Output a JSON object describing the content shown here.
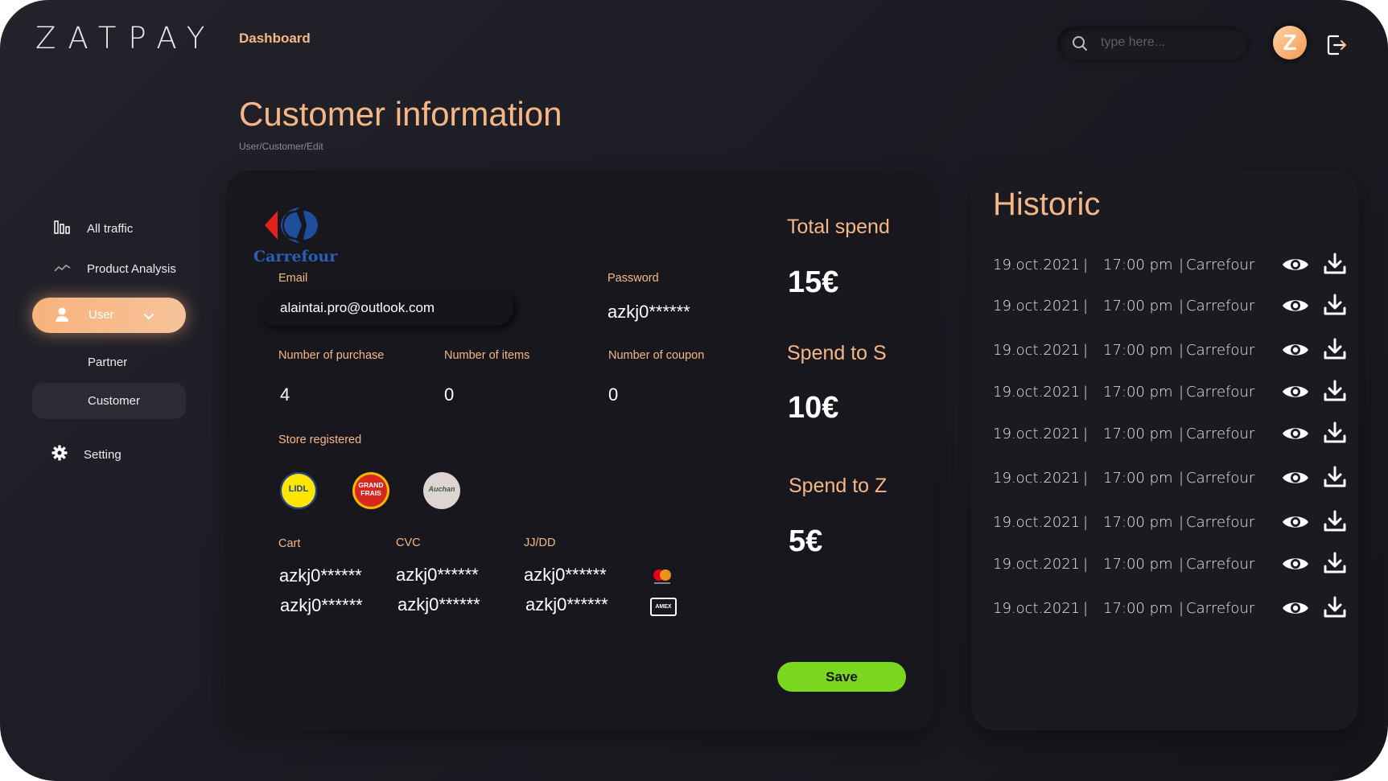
{
  "header": {
    "logo": "ZATPAY",
    "nav_active": "Dashboard",
    "search_placeholder": "type here...",
    "avatar_letter": "Z"
  },
  "page": {
    "title": "Customer information",
    "breadcrumb": "User/Customer/Edit"
  },
  "sidebar": {
    "items": [
      {
        "label": "All traffic",
        "icon": "bar-chart-icon"
      },
      {
        "label": "Product Analysis",
        "icon": "trend-line-icon"
      },
      {
        "label": "User",
        "icon": "user-icon",
        "active": true
      },
      {
        "label": "Partner"
      },
      {
        "label": "Customer",
        "selected": true
      },
      {
        "label": "Setting",
        "icon": "gear-icon"
      }
    ]
  },
  "customer": {
    "brand": "Carrefour",
    "email_label": "Email",
    "email_value": "alaintai.pro@outlook.com",
    "password_label": "Password",
    "password_value": "azkj0******",
    "purchases_label": "Number of purchase",
    "purchases_value": "4",
    "items_label": "Number of items",
    "items_value": "0",
    "coupon_label": "Number of coupon",
    "coupon_value": "0",
    "stores_label": "Store registered",
    "stores": [
      "LIDL",
      "GRAND FRAIS",
      "Auchan"
    ],
    "cart_label": "Cart",
    "cvc_label": "CVC",
    "date_label": "JJ/DD",
    "cards": [
      {
        "cart": "azkj0******",
        "cvc": "azkj0******",
        "date": "azkj0******",
        "brand": "mastercard"
      },
      {
        "cart": "azkj0******",
        "cvc": "azkj0******",
        "date": "azkj0******",
        "brand": "AMEX"
      }
    ],
    "save_label": "Save"
  },
  "stats": {
    "total_label": "Total spend",
    "total_value": "15€",
    "spend_s_label": "Spend to S",
    "spend_s_value": "10€",
    "spend_z_label": "Spend to Z",
    "spend_z_value": "5€"
  },
  "historic": {
    "title": "Historic",
    "rows": [
      {
        "date": "19.oct.2021",
        "time": "17:00 pm",
        "store": "Carrefour"
      },
      {
        "date": "19.oct.2021",
        "time": "17:00 pm",
        "store": "Carrefour"
      },
      {
        "date": "19.oct.2021",
        "time": "17:00 pm",
        "store": "Carrefour"
      },
      {
        "date": "19.oct.2021",
        "time": "17:00 pm",
        "store": "Carrefour"
      },
      {
        "date": "19.oct.2021",
        "time": "17:00 pm",
        "store": "Carrefour"
      },
      {
        "date": "19.oct.2021",
        "time": "17:00 pm",
        "store": "Carrefour"
      },
      {
        "date": "19.oct.2021",
        "time": "17:00 pm",
        "store": "Carrefour"
      },
      {
        "date": "19.oct.2021",
        "time": "17:00 pm",
        "store": "Carrefour"
      },
      {
        "date": "19.oct.2021",
        "time": "17:00 pm",
        "store": "Carrefour"
      }
    ]
  },
  "colors": {
    "accent": "#f6b787",
    "save": "#7ad61f",
    "background": "#1c1c24"
  }
}
